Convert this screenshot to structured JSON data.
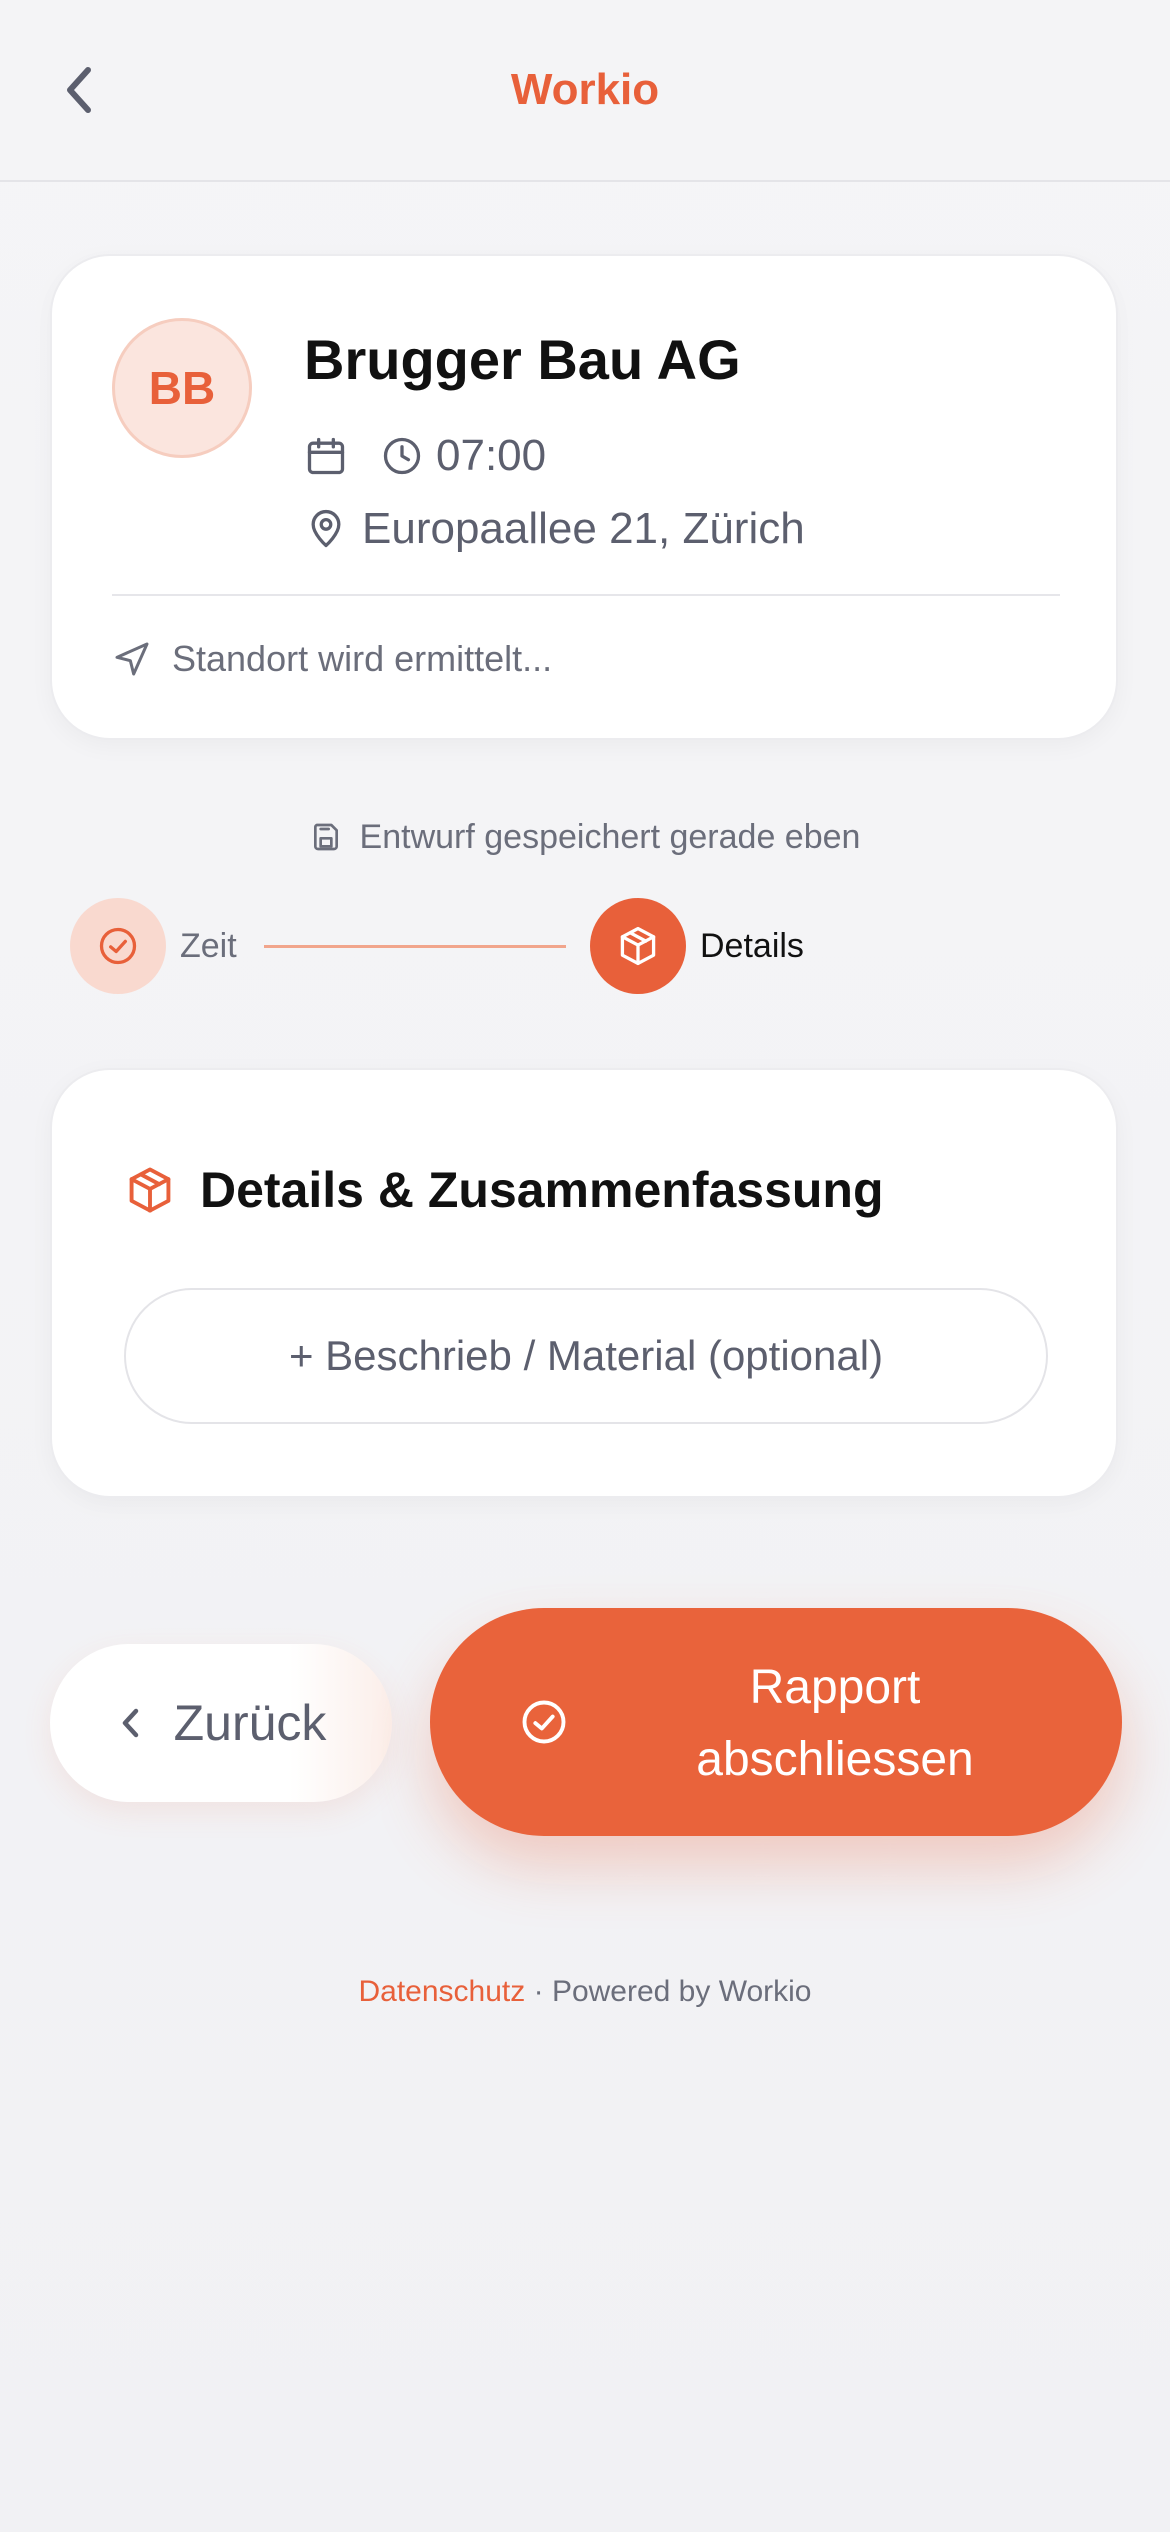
{
  "header": {
    "title": "Workio",
    "back_icon": "chevron-left-icon"
  },
  "job": {
    "avatar_initials": "BB",
    "client_name": "Brugger Bau AG",
    "time": "07:00",
    "address": "Europaallee 21, Zürich",
    "location_status": "Standort wird ermittelt..."
  },
  "draft": {
    "status": "Entwurf gespeichert gerade eben"
  },
  "stepper": {
    "steps": [
      {
        "label": "Zeit",
        "state": "completed",
        "icon": "check-circle-icon"
      },
      {
        "label": "Details",
        "state": "active",
        "icon": "package-icon"
      }
    ]
  },
  "details": {
    "title": "Details & Zusammenfassung",
    "add_button_label": "+ Beschrieb / Material (optional)"
  },
  "actions": {
    "back_label": "Zurück",
    "finish_label_line1": "Rapport",
    "finish_label_line2": "abschliessen"
  },
  "footer": {
    "privacy_link": "Datenschutz",
    "separator": "·",
    "powered_by": "Powered by Workio"
  },
  "colors": {
    "accent": "#e8603a",
    "accent_light": "#f9d9cf",
    "text_primary": "#111111",
    "text_secondary": "#5c5f6e",
    "background": "#f4f4f6",
    "card": "#ffffff"
  }
}
